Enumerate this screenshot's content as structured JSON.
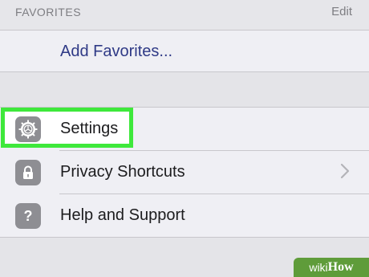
{
  "section_header": {
    "title": "FAVORITES",
    "edit_label": "Edit"
  },
  "favorites": {
    "add_label": "Add Favorites..."
  },
  "menu": {
    "items": [
      {
        "label": "Settings",
        "icon": "gear-icon",
        "highlighted": true,
        "has_chevron": false
      },
      {
        "label": "Privacy Shortcuts",
        "icon": "lock-icon",
        "highlighted": false,
        "has_chevron": true
      },
      {
        "label": "Help and Support",
        "icon": "question-icon",
        "highlighted": false,
        "has_chevron": false
      }
    ]
  },
  "watermark": {
    "prefix": "wiki",
    "suffix": "How"
  },
  "colors": {
    "highlight": "#3ee83b",
    "link": "#2f3a86",
    "icon_bg": "#8e8e93",
    "watermark_bg": "#5f9c3a"
  }
}
